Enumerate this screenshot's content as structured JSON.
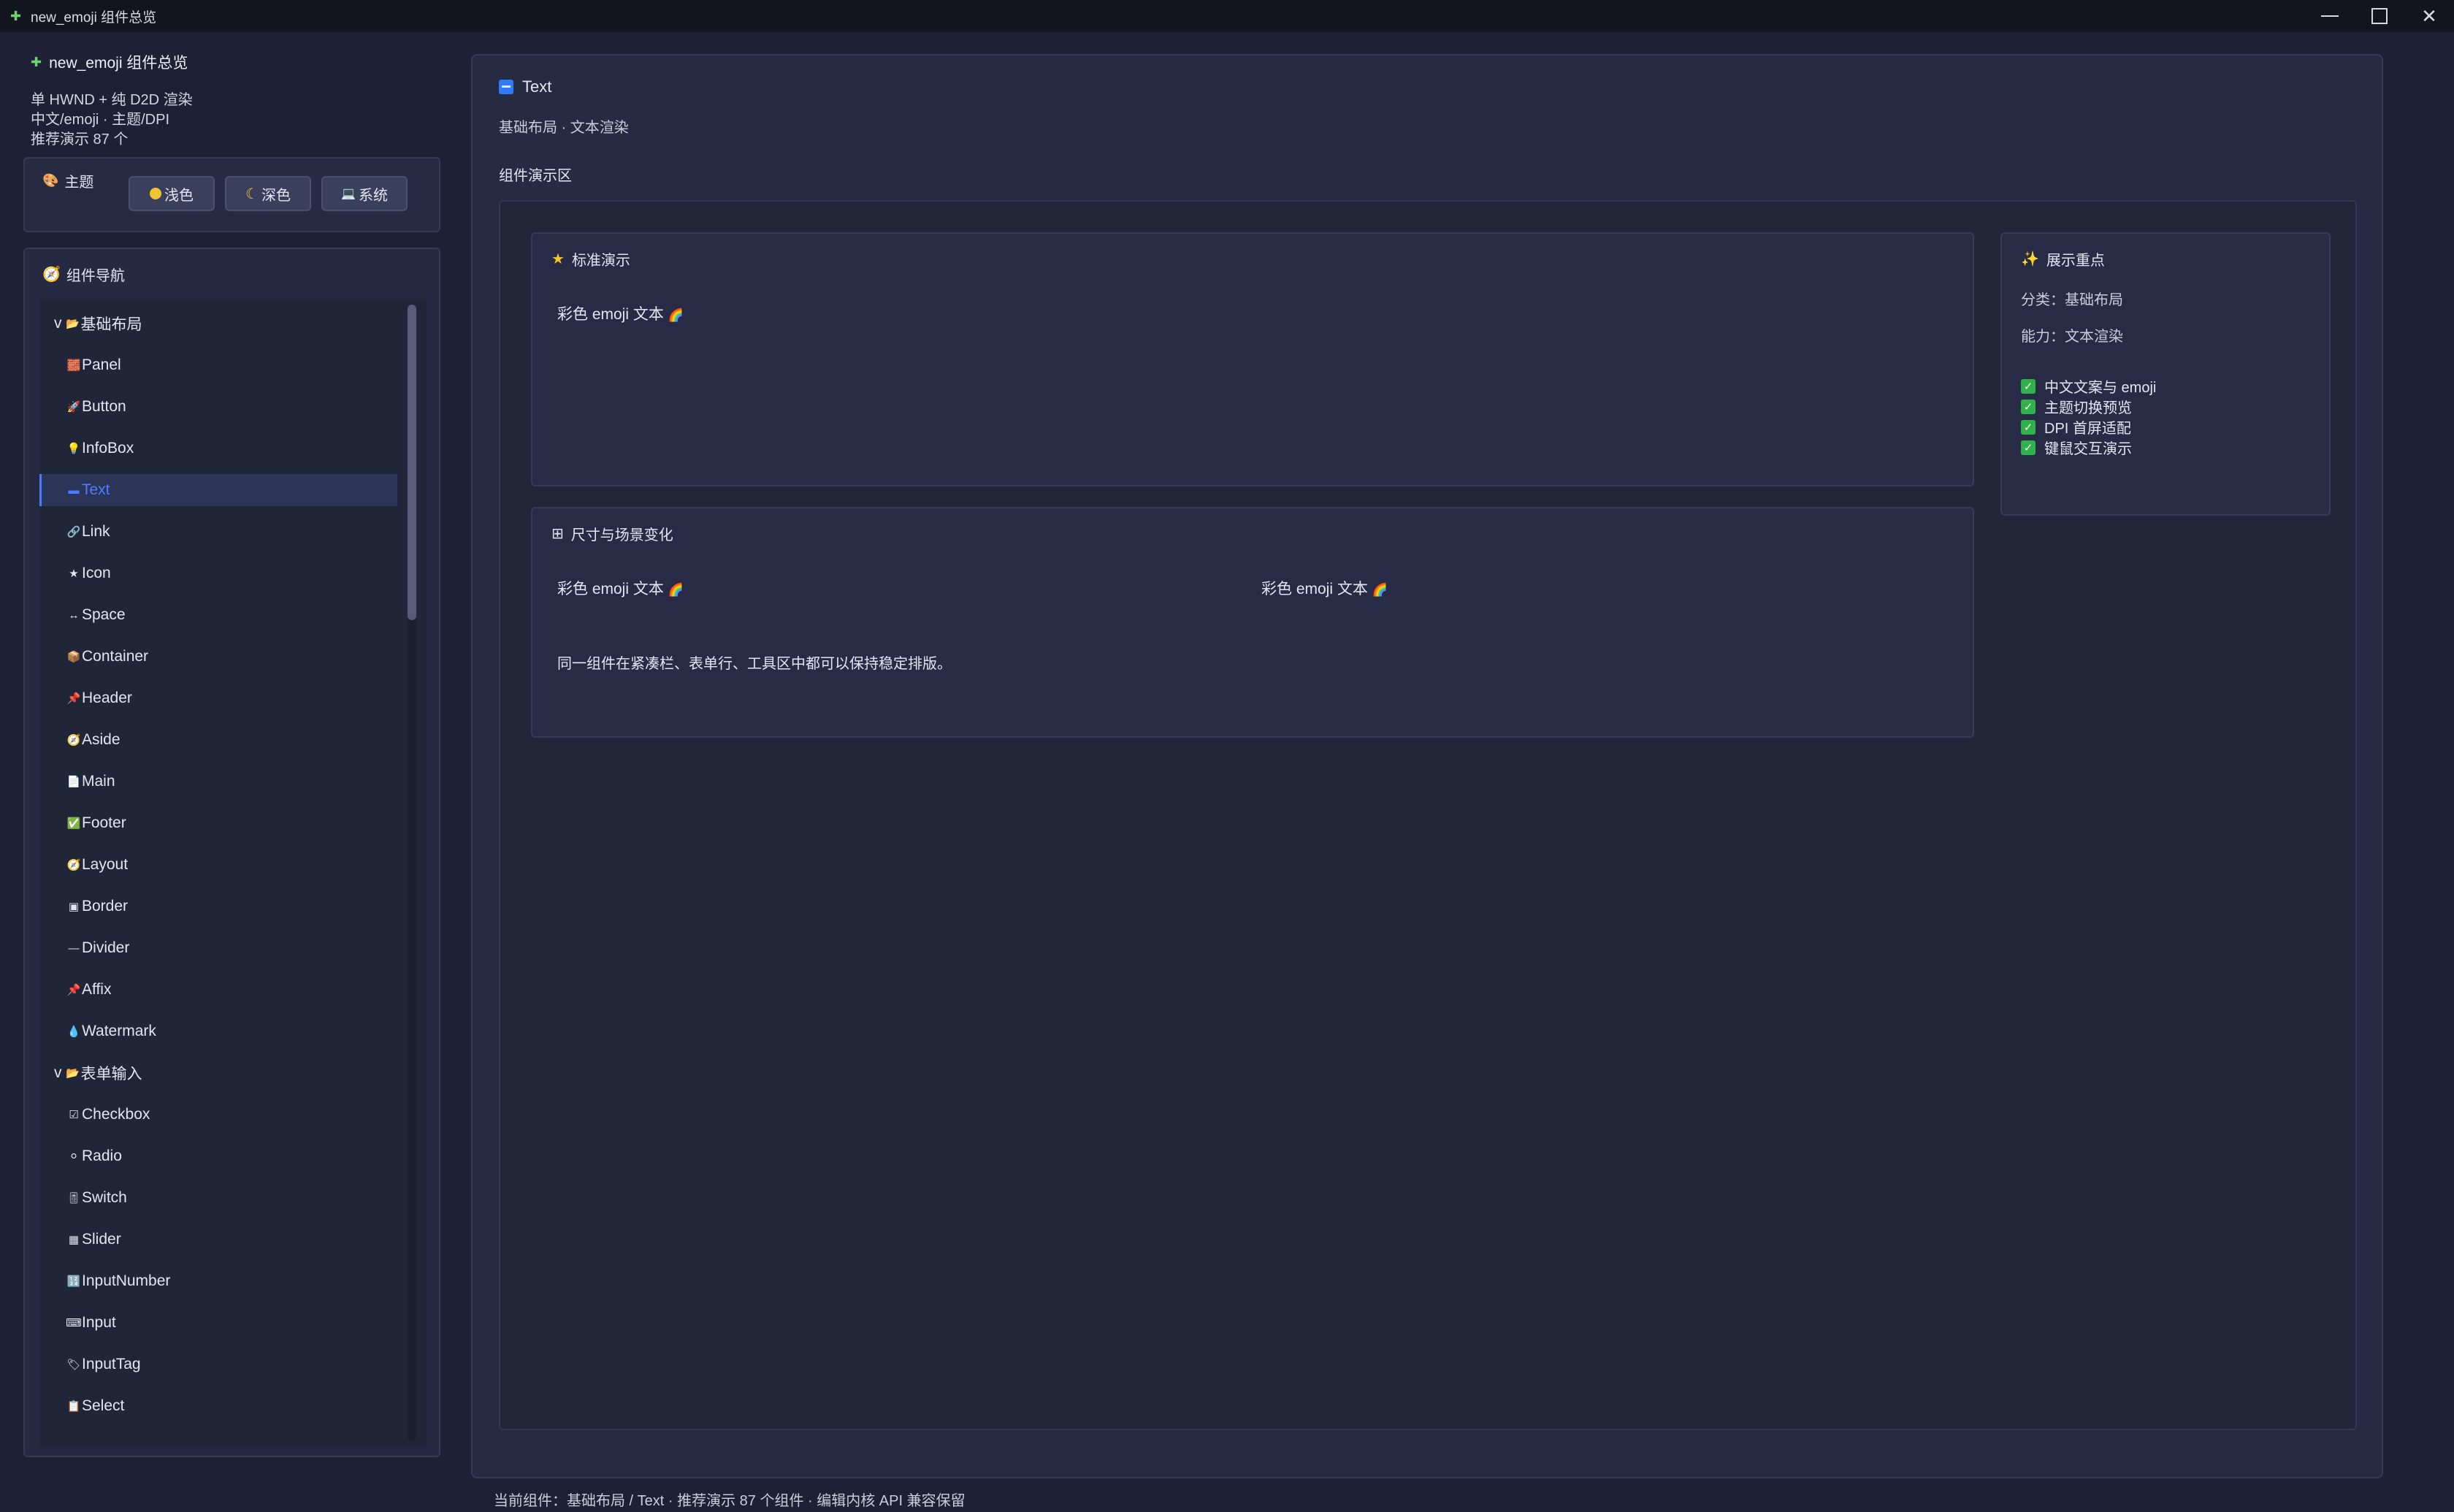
{
  "window": {
    "title": "new_emoji 组件总览",
    "app_icon": "puzzle-icon",
    "controls": [
      "minimize",
      "maximize",
      "close"
    ]
  },
  "sidebar": {
    "app_title": "new_emoji 组件总览",
    "info_lines": [
      "单 HWND + 纯 D2D 渲染",
      "中文/emoji · 主题/DPI",
      "推荐演示 87 个"
    ],
    "theme": {
      "label": "主题",
      "buttons": [
        {
          "label": "浅色",
          "icon": "sun-icon"
        },
        {
          "label": "深色",
          "icon": "moon-icon"
        },
        {
          "label": "系统",
          "icon": "laptop-icon"
        }
      ]
    },
    "nav": {
      "label": "组件导航",
      "items": [
        {
          "type": "group",
          "label": "基础布局",
          "prefix": "v",
          "icon": "📂"
        },
        {
          "type": "leaf",
          "label": "Panel",
          "icon": "🧱"
        },
        {
          "type": "leaf",
          "label": "Button",
          "icon": "🚀"
        },
        {
          "type": "leaf",
          "label": "InfoBox",
          "icon": "💡"
        },
        {
          "type": "leaf",
          "label": "Text",
          "icon": "▬",
          "selected": true
        },
        {
          "type": "leaf",
          "label": "Link",
          "icon": "🔗"
        },
        {
          "type": "leaf",
          "label": "Icon",
          "icon": "★"
        },
        {
          "type": "leaf",
          "label": "Space",
          "icon": "↔"
        },
        {
          "type": "leaf",
          "label": "Container",
          "icon": "📦"
        },
        {
          "type": "leaf",
          "label": "Header",
          "icon": "📌"
        },
        {
          "type": "leaf",
          "label": "Aside",
          "icon": "🧭"
        },
        {
          "type": "leaf",
          "label": "Main",
          "icon": "📄"
        },
        {
          "type": "leaf",
          "label": "Footer",
          "icon": "✅"
        },
        {
          "type": "leaf",
          "label": "Layout",
          "icon": "🧭"
        },
        {
          "type": "leaf",
          "label": "Border",
          "icon": "▣"
        },
        {
          "type": "leaf",
          "label": "Divider",
          "icon": "—"
        },
        {
          "type": "leaf",
          "label": "Affix",
          "icon": "📌"
        },
        {
          "type": "leaf",
          "label": "Watermark",
          "icon": "💧"
        },
        {
          "type": "group",
          "label": "表单输入",
          "prefix": "v",
          "icon": "📂"
        },
        {
          "type": "leaf",
          "label": "Checkbox",
          "icon": "☑"
        },
        {
          "type": "leaf",
          "label": "Radio",
          "icon": "⚪"
        },
        {
          "type": "leaf",
          "label": "Switch",
          "icon": "🎚"
        },
        {
          "type": "leaf",
          "label": "Slider",
          "icon": "▦"
        },
        {
          "type": "leaf",
          "label": "InputNumber",
          "icon": "🔢"
        },
        {
          "type": "leaf",
          "label": "Input",
          "icon": "⌨"
        },
        {
          "type": "leaf",
          "label": "InputTag",
          "icon": "🏷"
        },
        {
          "type": "leaf",
          "label": "Select",
          "icon": "📋"
        }
      ]
    }
  },
  "main": {
    "title": "Text",
    "subtitle": "基础布局 · 文本渲染",
    "demo_area_label": "组件演示区",
    "standard_card": {
      "title": "标准演示",
      "text": "彩色 emoji 文本"
    },
    "size_card": {
      "title": "尺寸与场景变化",
      "text_left": "彩色 emoji 文本",
      "text_right": "彩色 emoji 文本",
      "note": "同一组件在紧凑栏、表单行、工具区中都可以保持稳定排版。"
    },
    "focus_card": {
      "title": "展示重点",
      "category": "分类：基础布局",
      "capability": "能力：文本渲染",
      "checks": [
        "中文文案与 emoji",
        "主题切换预览",
        "DPI 首屏适配",
        "键鼠交互演示"
      ]
    }
  },
  "status_bar": "当前组件：基础布局 / Text · 推荐演示 87 个组件 · 编辑内核 API 兼容保留",
  "colors": {
    "background": "#1e2136",
    "panel": "#262a43",
    "accent": "#4f7cff",
    "check": "#2fb24a"
  }
}
